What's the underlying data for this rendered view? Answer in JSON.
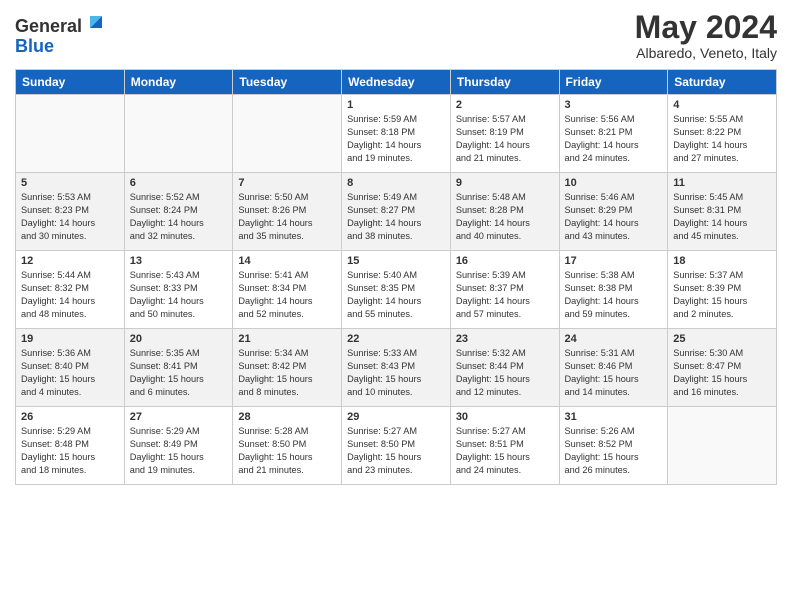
{
  "logo": {
    "line1": "General",
    "line2": "Blue"
  },
  "title": "May 2024",
  "location": "Albaredo, Veneto, Italy",
  "weekdays": [
    "Sunday",
    "Monday",
    "Tuesday",
    "Wednesday",
    "Thursday",
    "Friday",
    "Saturday"
  ],
  "weeks": [
    [
      {
        "day": "",
        "info": ""
      },
      {
        "day": "",
        "info": ""
      },
      {
        "day": "",
        "info": ""
      },
      {
        "day": "1",
        "info": "Sunrise: 5:59 AM\nSunset: 8:18 PM\nDaylight: 14 hours\nand 19 minutes."
      },
      {
        "day": "2",
        "info": "Sunrise: 5:57 AM\nSunset: 8:19 PM\nDaylight: 14 hours\nand 21 minutes."
      },
      {
        "day": "3",
        "info": "Sunrise: 5:56 AM\nSunset: 8:21 PM\nDaylight: 14 hours\nand 24 minutes."
      },
      {
        "day": "4",
        "info": "Sunrise: 5:55 AM\nSunset: 8:22 PM\nDaylight: 14 hours\nand 27 minutes."
      }
    ],
    [
      {
        "day": "5",
        "info": "Sunrise: 5:53 AM\nSunset: 8:23 PM\nDaylight: 14 hours\nand 30 minutes."
      },
      {
        "day": "6",
        "info": "Sunrise: 5:52 AM\nSunset: 8:24 PM\nDaylight: 14 hours\nand 32 minutes."
      },
      {
        "day": "7",
        "info": "Sunrise: 5:50 AM\nSunset: 8:26 PM\nDaylight: 14 hours\nand 35 minutes."
      },
      {
        "day": "8",
        "info": "Sunrise: 5:49 AM\nSunset: 8:27 PM\nDaylight: 14 hours\nand 38 minutes."
      },
      {
        "day": "9",
        "info": "Sunrise: 5:48 AM\nSunset: 8:28 PM\nDaylight: 14 hours\nand 40 minutes."
      },
      {
        "day": "10",
        "info": "Sunrise: 5:46 AM\nSunset: 8:29 PM\nDaylight: 14 hours\nand 43 minutes."
      },
      {
        "day": "11",
        "info": "Sunrise: 5:45 AM\nSunset: 8:31 PM\nDaylight: 14 hours\nand 45 minutes."
      }
    ],
    [
      {
        "day": "12",
        "info": "Sunrise: 5:44 AM\nSunset: 8:32 PM\nDaylight: 14 hours\nand 48 minutes."
      },
      {
        "day": "13",
        "info": "Sunrise: 5:43 AM\nSunset: 8:33 PM\nDaylight: 14 hours\nand 50 minutes."
      },
      {
        "day": "14",
        "info": "Sunrise: 5:41 AM\nSunset: 8:34 PM\nDaylight: 14 hours\nand 52 minutes."
      },
      {
        "day": "15",
        "info": "Sunrise: 5:40 AM\nSunset: 8:35 PM\nDaylight: 14 hours\nand 55 minutes."
      },
      {
        "day": "16",
        "info": "Sunrise: 5:39 AM\nSunset: 8:37 PM\nDaylight: 14 hours\nand 57 minutes."
      },
      {
        "day": "17",
        "info": "Sunrise: 5:38 AM\nSunset: 8:38 PM\nDaylight: 14 hours\nand 59 minutes."
      },
      {
        "day": "18",
        "info": "Sunrise: 5:37 AM\nSunset: 8:39 PM\nDaylight: 15 hours\nand 2 minutes."
      }
    ],
    [
      {
        "day": "19",
        "info": "Sunrise: 5:36 AM\nSunset: 8:40 PM\nDaylight: 15 hours\nand 4 minutes."
      },
      {
        "day": "20",
        "info": "Sunrise: 5:35 AM\nSunset: 8:41 PM\nDaylight: 15 hours\nand 6 minutes."
      },
      {
        "day": "21",
        "info": "Sunrise: 5:34 AM\nSunset: 8:42 PM\nDaylight: 15 hours\nand 8 minutes."
      },
      {
        "day": "22",
        "info": "Sunrise: 5:33 AM\nSunset: 8:43 PM\nDaylight: 15 hours\nand 10 minutes."
      },
      {
        "day": "23",
        "info": "Sunrise: 5:32 AM\nSunset: 8:44 PM\nDaylight: 15 hours\nand 12 minutes."
      },
      {
        "day": "24",
        "info": "Sunrise: 5:31 AM\nSunset: 8:46 PM\nDaylight: 15 hours\nand 14 minutes."
      },
      {
        "day": "25",
        "info": "Sunrise: 5:30 AM\nSunset: 8:47 PM\nDaylight: 15 hours\nand 16 minutes."
      }
    ],
    [
      {
        "day": "26",
        "info": "Sunrise: 5:29 AM\nSunset: 8:48 PM\nDaylight: 15 hours\nand 18 minutes."
      },
      {
        "day": "27",
        "info": "Sunrise: 5:29 AM\nSunset: 8:49 PM\nDaylight: 15 hours\nand 19 minutes."
      },
      {
        "day": "28",
        "info": "Sunrise: 5:28 AM\nSunset: 8:50 PM\nDaylight: 15 hours\nand 21 minutes."
      },
      {
        "day": "29",
        "info": "Sunrise: 5:27 AM\nSunset: 8:50 PM\nDaylight: 15 hours\nand 23 minutes."
      },
      {
        "day": "30",
        "info": "Sunrise: 5:27 AM\nSunset: 8:51 PM\nDaylight: 15 hours\nand 24 minutes."
      },
      {
        "day": "31",
        "info": "Sunrise: 5:26 AM\nSunset: 8:52 PM\nDaylight: 15 hours\nand 26 minutes."
      },
      {
        "day": "",
        "info": ""
      }
    ]
  ]
}
